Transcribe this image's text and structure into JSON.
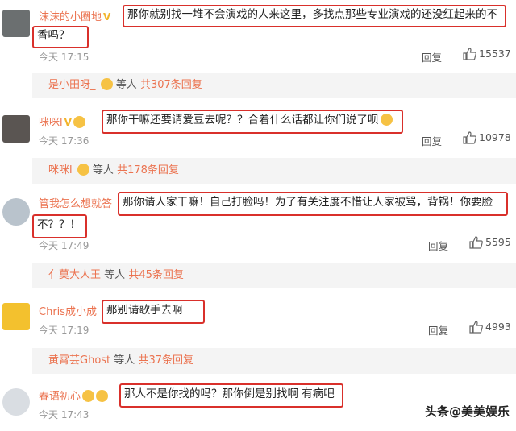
{
  "comments": [
    {
      "username": "沫沫的小圈地",
      "badge": "V",
      "text_line1": "那你就别找一堆不会演戏的人来这里，多找点那些专业演戏的还没红起来的不",
      "text_line2": "香吗？",
      "time": "今天 17:15",
      "reply_label": "回复",
      "likes": "15537",
      "subreply": {
        "name": "是小田呀_",
        "mid": "等人",
        "count": "共307条回复"
      }
    },
    {
      "username": "咪咪l",
      "badge": "V",
      "text": "那你干嘛还要请爱豆去呢？？合着什么话都让你们说了呗",
      "time": "今天 17:36",
      "reply_label": "回复",
      "likes": "10978",
      "subreply": {
        "name": "咪咪l",
        "mid": "等人",
        "count": "共178条回复"
      }
    },
    {
      "username": "管我怎么想就答",
      "text_line1": "那你请人家干嘛！自己打脸吗！为了有关注度不惜让人家被骂，背锅！你要脸",
      "text_line2": "不？？！",
      "time": "今天 17:49",
      "reply_label": "回复",
      "likes": "5595",
      "subreply": {
        "name": "亻莫大人王",
        "mid": "等人",
        "count": "共45条回复"
      }
    },
    {
      "username": "Chris成小成",
      "text": "那别请歌手去啊",
      "time": "今天 17:19",
      "reply_label": "回复",
      "likes": "4993",
      "subreply": {
        "name": "黄霄芸Ghost",
        "mid": "等人",
        "count": "共37条回复"
      }
    },
    {
      "username": "春语初心",
      "text": "那人不是你找的吗？那你倒是别找啊 有病吧",
      "time": "今天 17:43"
    }
  ],
  "watermark": "头条@美美娱乐",
  "icons": {
    "like": "thumbs-up-icon"
  },
  "colors": {
    "username": "#eb7350",
    "highlight": "#d9302b",
    "subreply_bg": "#f4f4f4"
  }
}
